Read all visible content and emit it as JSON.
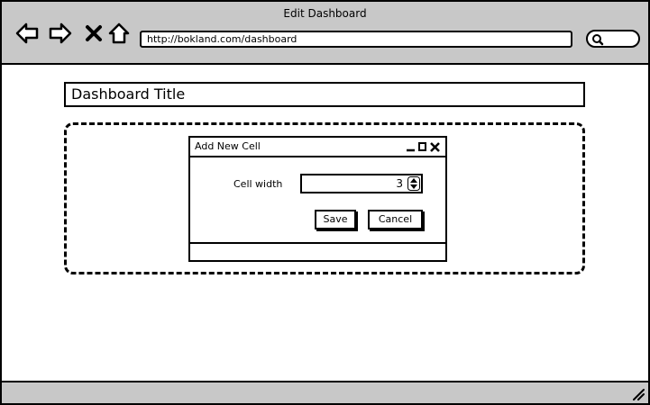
{
  "window": {
    "title": "Edit Dashboard",
    "address_url": "http://bokland.com/dashboard"
  },
  "toolbar": {
    "icons": [
      "back-arrow-icon",
      "forward-arrow-icon",
      "close-x-icon",
      "home-icon",
      "search-icon"
    ]
  },
  "dashboard": {
    "title_value": "Dashboard Title"
  },
  "dialog": {
    "title": "Add New Cell",
    "field_label": "Cell width",
    "cell_width_value": "3",
    "save_label": "Save",
    "cancel_label": "Cancel"
  },
  "colors": {
    "chrome_gray": "#c8c8c8",
    "border": "#000000",
    "background": "#ffffff"
  }
}
